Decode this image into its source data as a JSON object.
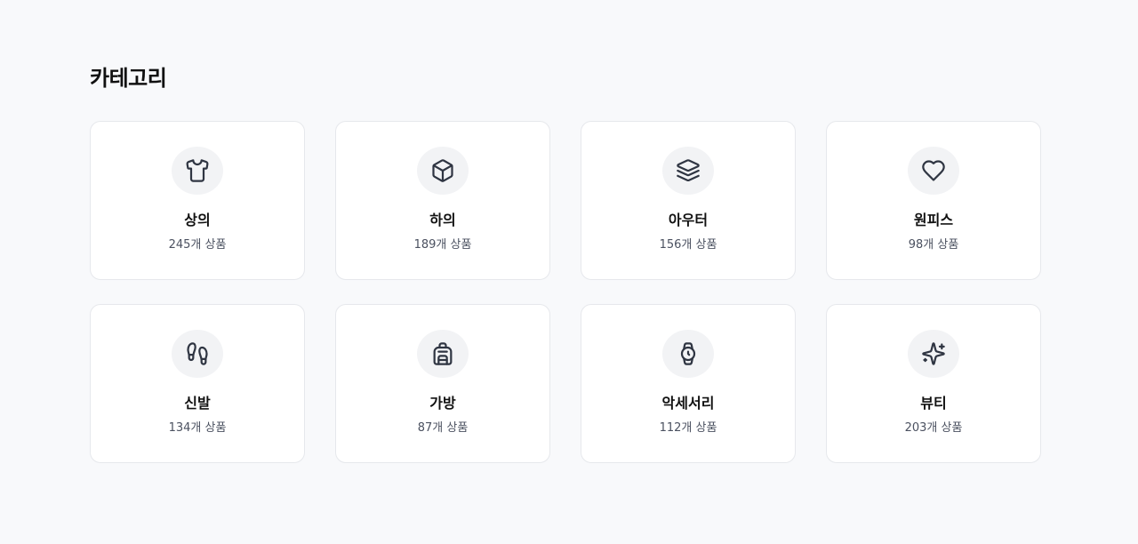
{
  "section": {
    "title": "카테고리"
  },
  "categories": [
    {
      "icon": "shirt-icon",
      "name": "상의",
      "count": "245개 상품"
    },
    {
      "icon": "box-icon",
      "name": "하의",
      "count": "189개 상품"
    },
    {
      "icon": "layers-icon",
      "name": "아우터",
      "count": "156개 상품"
    },
    {
      "icon": "heart-icon",
      "name": "원피스",
      "count": "98개 상품"
    },
    {
      "icon": "footprints-icon",
      "name": "신발",
      "count": "134개 상품"
    },
    {
      "icon": "backpack-icon",
      "name": "가방",
      "count": "87개 상품"
    },
    {
      "icon": "watch-icon",
      "name": "악세서리",
      "count": "112개 상품"
    },
    {
      "icon": "sparkles-icon",
      "name": "뷰티",
      "count": "203개 상품"
    }
  ],
  "colors": {
    "background": "#f8f9fb",
    "card": "#ffffff",
    "card_border": "#e6e8ec",
    "icon_bg": "#f2f3f5",
    "icon_stroke": "#2f3542",
    "title_text": "#111111",
    "count_text": "#4b5160"
  }
}
